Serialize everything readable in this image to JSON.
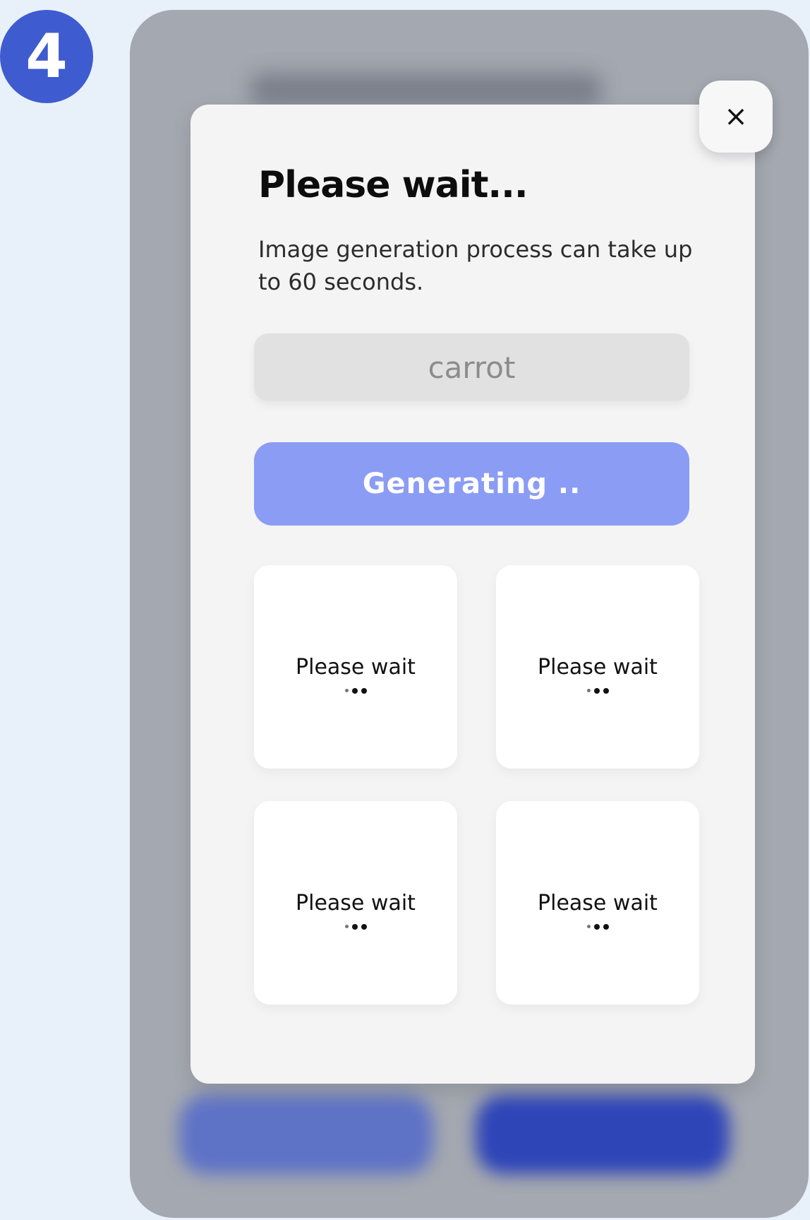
{
  "step_badge": "4",
  "dialog": {
    "close_icon": "×",
    "title": "Please wait...",
    "description": "Image generation process can take up to 60 seconds.",
    "prompt_value": "carrot",
    "generate_button_label": "Generating ..",
    "placeholders": [
      {
        "label": "Please wait"
      },
      {
        "label": "Please wait"
      },
      {
        "label": "Please wait"
      },
      {
        "label": "Please wait"
      }
    ]
  },
  "colors": {
    "badge": "#3f5bd0",
    "generate_button": "#8b9cf4",
    "background_left_button": "#5e72c6",
    "background_right_button": "#2e45b8"
  }
}
